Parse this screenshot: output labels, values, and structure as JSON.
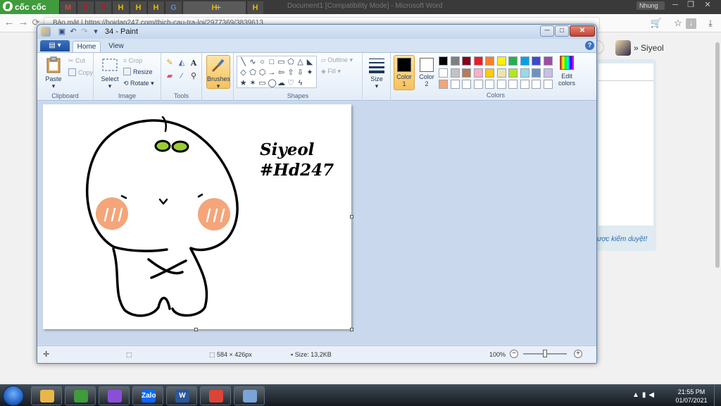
{
  "browser": {
    "logo_text": "cốc cốc",
    "tabs": [
      {
        "icon": "gmail-icon",
        "glyph": "M",
        "color": "#d44638"
      },
      {
        "icon": "pinterest-icon",
        "glyph": "P",
        "color": "#e60023"
      },
      {
        "icon": "pinterest-icon",
        "glyph": "P",
        "color": "#e60023"
      },
      {
        "icon": "hoidap-icon",
        "glyph": "H",
        "color": "#e8b800"
      },
      {
        "icon": "hoidap-icon",
        "glyph": "H",
        "color": "#e8b800"
      },
      {
        "icon": "hoidap-icon",
        "glyph": "H",
        "color": "#e8b800"
      },
      {
        "icon": "translate-icon",
        "glyph": "G",
        "color": "#4a8af4"
      },
      {
        "icon": "hoidap-icon",
        "glyph": "H",
        "color": "#e8b800"
      },
      {
        "icon": "hoidap-icon",
        "glyph": "H",
        "color": "#e8b800"
      }
    ],
    "doc_title_ghost": "Document1 [Compatibility Mode] - Microsoft Word",
    "user_chip": "Nhung",
    "url": "Bảo mật | https://hoidap247.com/thich-cau-tra-loi/2977369/3839613"
  },
  "webpage": {
    "username": "Siyeol",
    "review_note": "ược kiểm duyệt!"
  },
  "paint": {
    "title": "34 - Paint",
    "tabs": {
      "home": "Home",
      "view": "View"
    },
    "clipboard": {
      "paste": "Paste",
      "cut": "Cut",
      "copy": "Copy",
      "label": "Clipboard"
    },
    "image": {
      "select": "Select",
      "crop": "Crop",
      "resize": "Resize",
      "rotate": "Rotate",
      "label": "Image"
    },
    "tools": {
      "label": "Tools"
    },
    "brushes": "Brushes",
    "shapes": {
      "outline": "Outline",
      "fill": "Fill",
      "label": "Shapes"
    },
    "size": "Size",
    "colors": {
      "color1": "Color",
      "color1_num": "1",
      "color2": "Color",
      "color2_num": "2",
      "edit": "Edit colors",
      "label": "Colors",
      "color1_value": "#000000",
      "color2_value": "#ffffff",
      "palette_row1": [
        "#000000",
        "#7f7f7f",
        "#880015",
        "#ed1c24",
        "#ff7f27",
        "#fff200",
        "#22b14c",
        "#00a2e8",
        "#3f48cc",
        "#a349a4"
      ],
      "palette_row2": [
        "#ffffff",
        "#c3c3c3",
        "#b97a57",
        "#ffaec9",
        "#ffc90e",
        "#efe4b0",
        "#b5e61d",
        "#99d9ea",
        "#7092be",
        "#c8bfe7"
      ],
      "palette_row3": [
        "#f4a57a",
        "",
        "",
        "",
        "",
        "",
        "",
        "",
        "",
        ""
      ]
    },
    "canvas_text": {
      "line1": "Siyeol",
      "line2": "#Hd247"
    },
    "status": {
      "dimensions": "584 × 426px",
      "size": "Size: 13,2KB",
      "zoom": "100%"
    }
  },
  "taskbar": {
    "items": [
      {
        "name": "explorer-icon",
        "glyph": "",
        "color": "#e9b64a"
      },
      {
        "name": "coccoc-icon",
        "glyph": "",
        "color": "#3f9b3b"
      },
      {
        "name": "game-icon",
        "glyph": "",
        "color": "#8a4fd6"
      },
      {
        "name": "zalo-icon",
        "glyph": "Zalo",
        "color": "#0a68ff"
      },
      {
        "name": "word-icon",
        "glyph": "W",
        "color": "#2b579a"
      },
      {
        "name": "chrome-icon",
        "glyph": "",
        "color": "#db4437"
      },
      {
        "name": "paint-icon",
        "glyph": "",
        "color": "#7aa3d8"
      }
    ],
    "time": "21:55 PM",
    "date": "01/07/2021"
  }
}
